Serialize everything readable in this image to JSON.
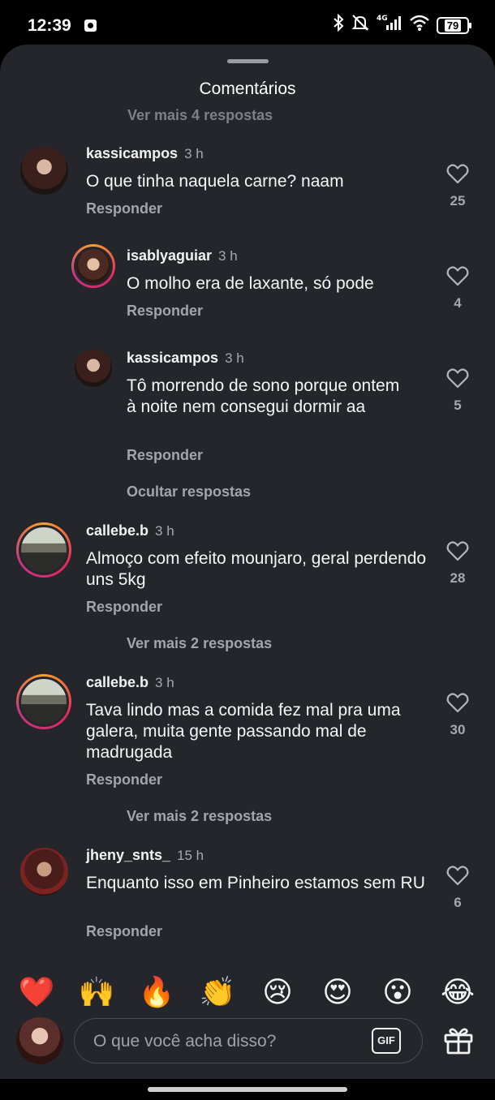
{
  "status_bar": {
    "time": "12:39",
    "icons": [
      "app-notification-icon",
      "bluetooth-icon",
      "mute-icon",
      "4g-signal-icon",
      "wifi-icon",
      "battery-icon"
    ],
    "network": "4G",
    "battery": "79"
  },
  "sheet": {
    "title": "Comentários",
    "cut_off_link": "Ver mais 4 respostas"
  },
  "comments": [
    {
      "user": "kassicampos",
      "time": "3 h",
      "text": "O que tinha naquela carne? naam",
      "reply": "Responder",
      "likes": "25"
    },
    {
      "user": "isablyaguiar",
      "time": "3 h",
      "text": "O molho era de laxante, só pode",
      "reply": "Responder",
      "likes": "4"
    },
    {
      "user": "kassicampos",
      "time": "3 h",
      "text": "Tô morrendo de sono porque ontem à noite nem consegui dormir aa",
      "reply": "Responder",
      "likes": "5"
    },
    {
      "user": "callebe.b",
      "time": "3 h",
      "text": "Almoço com efeito mounjaro, geral perdendo uns 5kg",
      "reply": "Responder",
      "likes": "28"
    },
    {
      "user": "callebe.b",
      "time": "3 h",
      "text": "Tava lindo mas a comida fez mal pra uma galera, muita gente passando mal de madrugada",
      "reply": "Responder",
      "likes": "30"
    },
    {
      "user": "jheny_snts_",
      "time": "15 h",
      "text": "Enquanto isso em Pinheiro estamos sem RU",
      "reply": "Responder",
      "likes": "6"
    }
  ],
  "thread_links": {
    "hide_replies": "Ocultar respostas",
    "more_replies_1": "Ver mais 2 respostas",
    "more_replies_2": "Ver mais 2 respostas"
  },
  "emoji_bar": [
    "❤️",
    "🙌",
    "🔥",
    "👏",
    "😢",
    "😍",
    "😮",
    "😂"
  ],
  "composer": {
    "placeholder": "O que você acha disso?",
    "gif_label": "GIF"
  },
  "colors": {
    "sheet_bg": "#25262b",
    "accent_ring": "#c13584",
    "muted_text": "#a6a8ae"
  }
}
